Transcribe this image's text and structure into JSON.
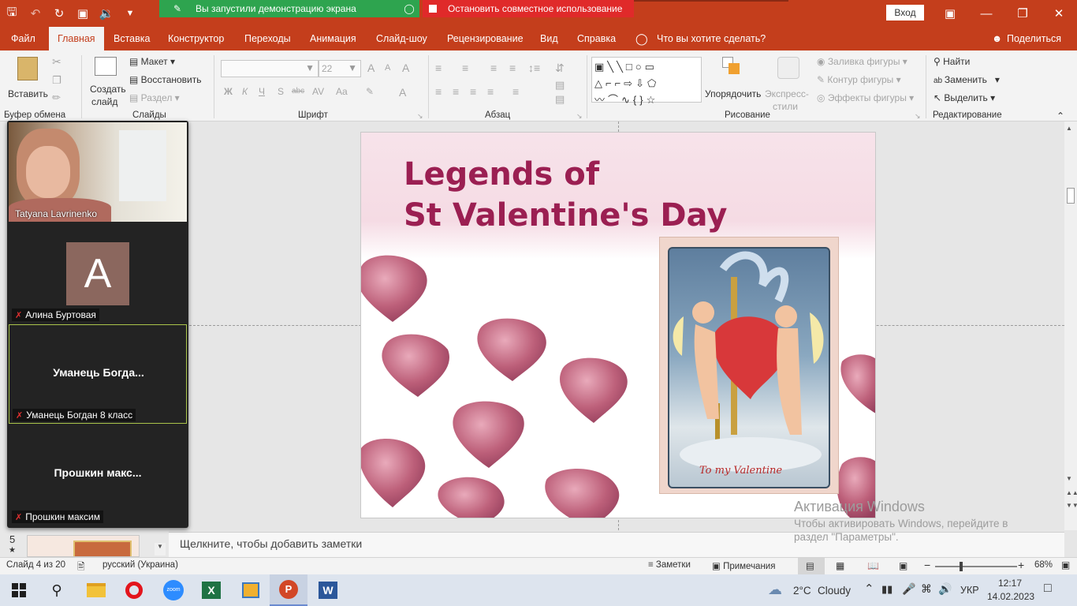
{
  "titlebar": {
    "share_banner": "Вы запустили демонстрацию экрана",
    "stop_banner": "Остановить совместное использование",
    "login": "Вход"
  },
  "tabs": [
    "Файл",
    "Главная",
    "Вставка",
    "Конструктор",
    "Переходы",
    "Анимация",
    "Слайд-шоу",
    "Рецензирование",
    "Вид",
    "Справка"
  ],
  "tell_me": "Что вы хотите сделать?",
  "share": "Поделиться",
  "ribbon": {
    "clipboard": {
      "paste": "Вставить",
      "label": "Буфер обмена"
    },
    "slides": {
      "new_slide_1": "Создать",
      "new_slide_2": "слайд",
      "layout": "Макет",
      "reset": "Восстановить",
      "section": "Раздел",
      "label": "Слайды"
    },
    "font": {
      "size": "22",
      "label": "Шрифт",
      "bold": "Ж",
      "italic": "К",
      "underline": "Ч",
      "shadow": "S",
      "strike": "abc",
      "spacing": "AV",
      "case": "Aa",
      "grow": "A",
      "shrink": "A",
      "clear": "A",
      "color": "A"
    },
    "paragraph": {
      "label": "Абзац"
    },
    "drawing": {
      "arrange": "Упорядочить",
      "quick_1": "Экспресс-",
      "quick_2": "стили",
      "fill": "Заливка фигуры",
      "outline": "Контур фигуры",
      "effects": "Эффекты фигуры",
      "label": "Рисование"
    },
    "editing": {
      "find": "Найти",
      "replace": "Заменить",
      "select": "Выделить",
      "label": "Редактирование"
    }
  },
  "zoom_tiles": [
    {
      "name": "Tatyana Lavrinenko"
    },
    {
      "avatar_letter": "A",
      "name": "Алина Буртовая"
    },
    {
      "center": "Уманець  Богда...",
      "name": "Уманець Богдан 8 класс"
    },
    {
      "center": "Прошкин  макс...",
      "name": "Прошкин максим"
    }
  ],
  "thumb": {
    "number": "5",
    "star": "★"
  },
  "slide": {
    "title_line1": "Legends of",
    "title_line2": "St Valentine's Day",
    "card_text": "To my Valentine"
  },
  "notes_placeholder": "Щелкните, чтобы добавить заметки",
  "activation": {
    "line1": "Активация Windows",
    "line2": "Чтобы активировать Windows, перейдите в",
    "line3": "раздел \"Параметры\"."
  },
  "status": {
    "slide": "Слайд 4 из 20",
    "lang": "русский (Украина)",
    "notes": "Заметки",
    "comments": "Примечания",
    "zoom": "68%"
  },
  "taskbar": {
    "weather_temp": "2°C",
    "weather_text": "Cloudy",
    "lang": "УКР",
    "time": "12:17",
    "date": "14.02.2023"
  },
  "colors": {
    "accent": "#c43e1c",
    "title_text": "#9b1f52",
    "heart": "#b8536f"
  }
}
